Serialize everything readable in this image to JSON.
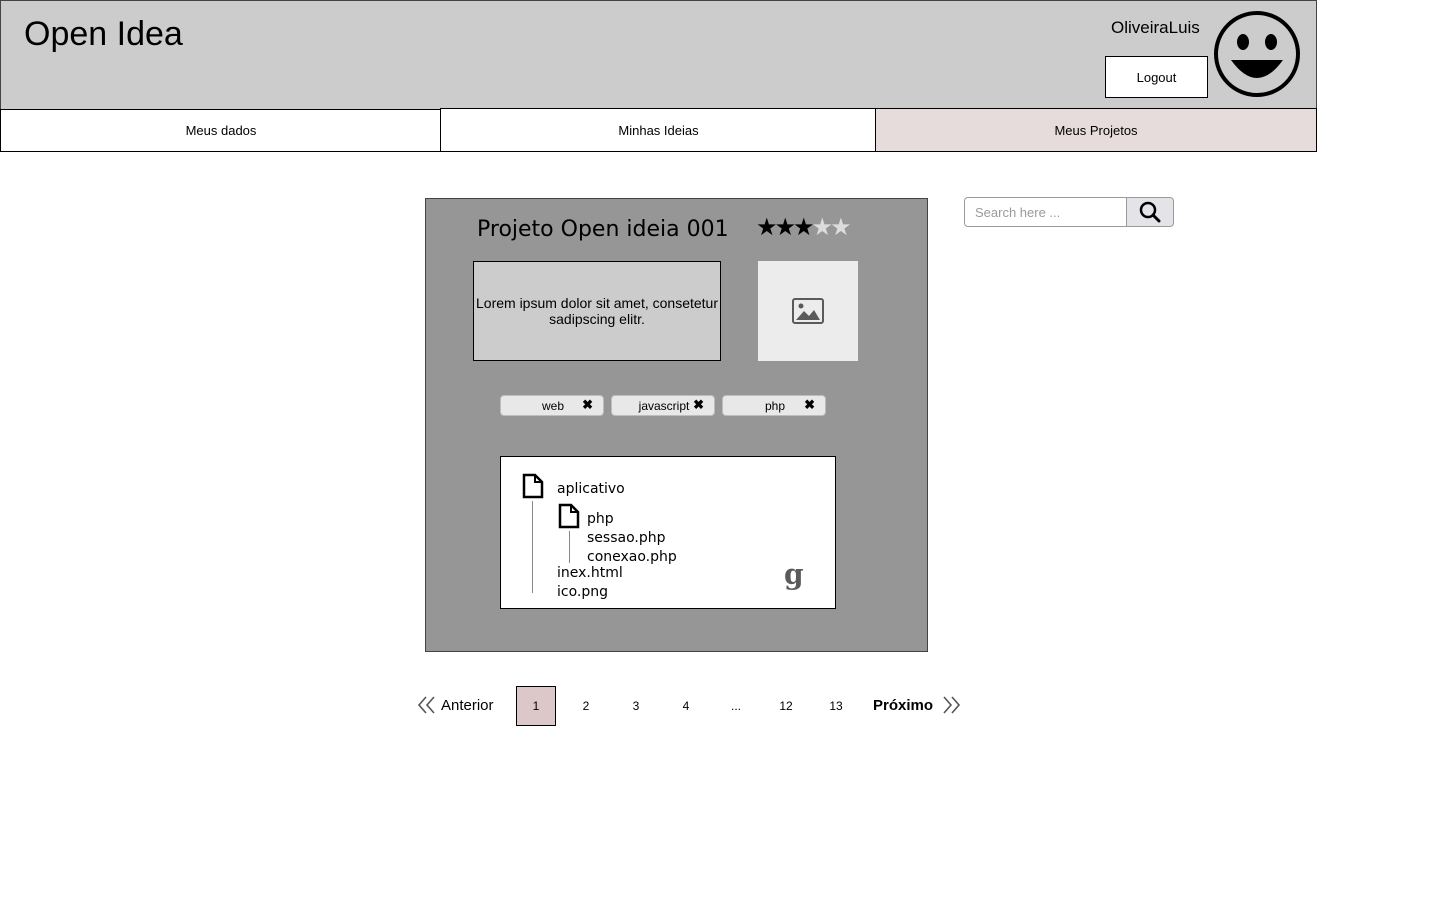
{
  "header": {
    "app_title": "Open Idea",
    "username": "OliveiraLuis",
    "logout_label": "Logout"
  },
  "nav": {
    "tabs": [
      {
        "label": "Meus dados",
        "active": false
      },
      {
        "label": "Minhas Ideias",
        "active": false
      },
      {
        "label": "Meus Projetos",
        "active": true
      }
    ]
  },
  "project": {
    "title": "Projeto Open ideia 001",
    "rating": 3,
    "rating_max": 5,
    "description": "Lorem ipsum dolor sit amet, consetetur sadipscing elitr.",
    "tags": [
      "web",
      "javascript",
      "php"
    ],
    "file_tree": {
      "root": "aplicativo",
      "folder": "php",
      "folder_files": [
        "sessao.php",
        "conexao.php"
      ],
      "root_files": [
        "inex.html",
        "ico.png"
      ]
    }
  },
  "search": {
    "placeholder": "Search here ..."
  },
  "pagination": {
    "prev_label": "Anterior",
    "next_label": "Próximo",
    "pages": [
      "1",
      "2",
      "3",
      "4",
      "...",
      "12",
      "13"
    ],
    "current": "1"
  },
  "icons": {
    "avatar": "smiley-face-icon",
    "image": "image-placeholder-icon",
    "file": "file-icon",
    "git": "git-icon",
    "search": "search-icon",
    "prev": "double-chevron-left-icon",
    "next": "double-chevron-right-icon",
    "tag_close": "close-icon"
  },
  "colors": {
    "header_bg": "#cccccc",
    "active_tab_bg": "#e6dcdc",
    "card_bg": "#969696",
    "current_page_bg": "#dcc8c8"
  }
}
